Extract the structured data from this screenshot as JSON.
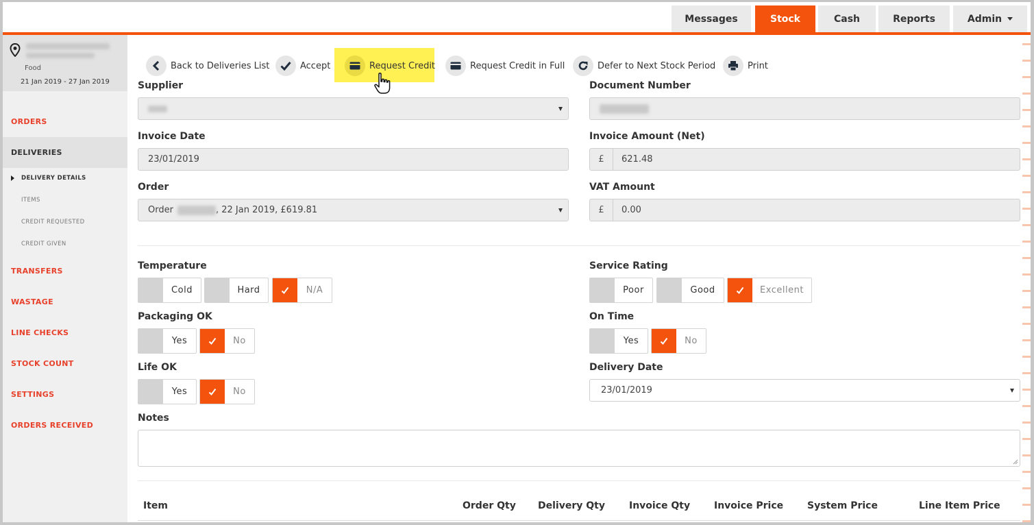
{
  "nav": {
    "tabs": [
      {
        "label": "Messages"
      },
      {
        "label": "Stock"
      },
      {
        "label": "Cash"
      },
      {
        "label": "Reports"
      },
      {
        "label": "Admin"
      }
    ]
  },
  "sidebar": {
    "site_type": "Food",
    "date_range": "21 Jan 2019 - 27 Jan 2019",
    "items": {
      "orders": "ORDERS",
      "deliveries": "DELIVERIES",
      "delivery_details": "DELIVERY DETAILS",
      "items": "ITEMS",
      "credit_requested": "CREDIT REQUESTED",
      "credit_given": "CREDIT GIVEN",
      "transfers": "TRANSFERS",
      "wastage": "WASTAGE",
      "line_checks": "LINE CHECKS",
      "stock_count": "STOCK COUNT",
      "settings": "SETTINGS",
      "orders_received": "ORDERS RECEIVED"
    }
  },
  "toolbar": {
    "back": "Back to Deliveries List",
    "accept": "Accept",
    "request_credit": "Request Credit",
    "request_credit_full": "Request Credit in Full",
    "defer": "Defer to Next Stock Period",
    "print": "Print"
  },
  "form": {
    "supplier_label": "Supplier",
    "document_number_label": "Document Number",
    "invoice_date_label": "Invoice Date",
    "invoice_date_value": "23/01/2019",
    "invoice_amount_label": "Invoice Amount (Net)",
    "currency_symbol": "£",
    "invoice_amount_value": "621.48",
    "order_label": "Order",
    "order_prefix": "Order",
    "order_suffix": ", 22 Jan 2019, £619.81",
    "vat_label": "VAT Amount",
    "vat_value": "0.00",
    "temperature_label": "Temperature",
    "temperature_options": [
      {
        "label": "Cold",
        "selected": false
      },
      {
        "label": "Hard",
        "selected": false
      },
      {
        "label": "N/A",
        "selected": true
      }
    ],
    "service_rating_label": "Service Rating",
    "service_rating_options": [
      {
        "label": "Poor",
        "selected": false
      },
      {
        "label": "Good",
        "selected": false
      },
      {
        "label": "Excellent",
        "selected": true
      }
    ],
    "packaging_label": "Packaging OK",
    "packaging_options": [
      {
        "label": "Yes",
        "selected": false
      },
      {
        "label": "No",
        "selected": true
      }
    ],
    "on_time_label": "On Time",
    "on_time_options": [
      {
        "label": "Yes",
        "selected": false
      },
      {
        "label": "No",
        "selected": true
      }
    ],
    "life_label": "Life OK",
    "life_options": [
      {
        "label": "Yes",
        "selected": false
      },
      {
        "label": "No",
        "selected": true
      }
    ],
    "delivery_date_label": "Delivery Date",
    "delivery_date_value": "23/01/2019",
    "notes_label": "Notes"
  },
  "table": {
    "columns": [
      "Item",
      "Order Qty",
      "Delivery Qty",
      "Invoice Qty",
      "Invoice Price",
      "System Price",
      "Line Item Price"
    ]
  },
  "colors": {
    "accent": "#f4530d",
    "nav_link": "#e8412b",
    "highlight": "#fff153"
  }
}
